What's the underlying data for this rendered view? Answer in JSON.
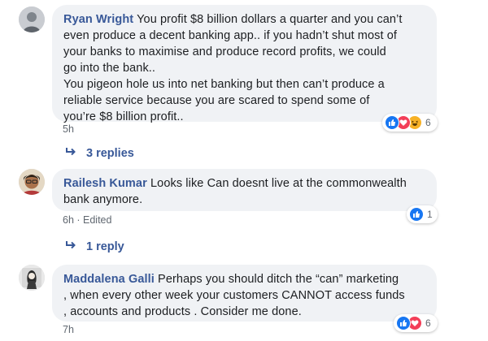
{
  "comments": [
    {
      "author": "Ryan Wright",
      "lines": [
        "You profit $8 billion dollars a quarter and you can’t",
        "even produce a decent banking app.. if you hadn’t shut most of",
        "your banks to maximise and produce record profits, we could",
        "go into the bank..",
        "You pigeon hole us into net banking but then can’t produce a",
        "reliable service because you are scared to spend some of",
        "you’re $8 billion profit.."
      ],
      "time": "5h",
      "reaction_count": "6",
      "reactions": [
        "like-icon",
        "love-icon",
        "haha-icon"
      ],
      "replies_label": "3 replies"
    },
    {
      "author": "Railesh Kumar",
      "lines": [
        "Looks like Can doesnt live at the commonwealth",
        "bank anymore."
      ],
      "time": "6h · Edited",
      "reaction_count": "1",
      "reactions": [
        "like-icon"
      ],
      "replies_label": "1 reply"
    },
    {
      "author": "Maddalena Galli",
      "lines": [
        "Perhaps you should ditch the “can” marketing",
        ", when every other week your customers CANNOT access funds",
        ", accounts and products . Consider me done."
      ],
      "time": "7h",
      "reaction_count": "6",
      "reactions": [
        "like-icon",
        "love-icon"
      ]
    }
  ],
  "colors": {
    "author": "#385898",
    "bubble": "#f0f2f5",
    "meta": "#606770",
    "like": "#1877f2",
    "love": "#f33e58",
    "haha": "#f7b125"
  },
  "reply_arrow_icon": "reply-arrow-icon"
}
